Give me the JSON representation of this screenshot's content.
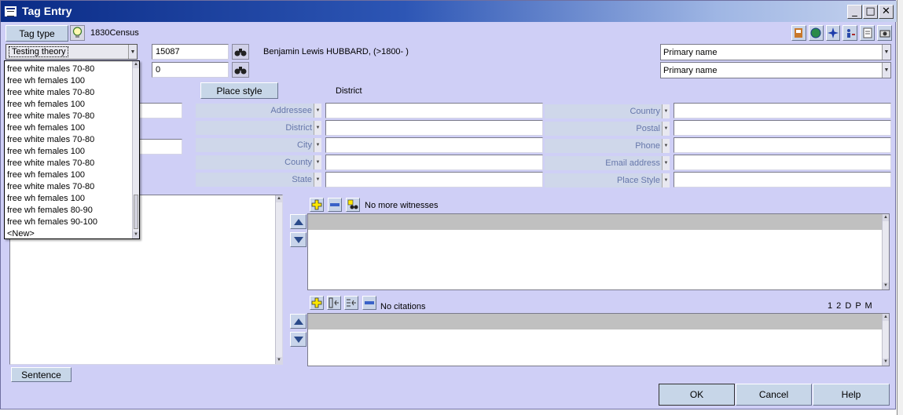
{
  "window": {
    "title": "Tag Entry",
    "minimize": "_",
    "maximize": "□",
    "close": "✕"
  },
  "header": {
    "tag_type_label": "Tag type",
    "tag_name": "1830Census"
  },
  "row1": {
    "role_value": "Testing theory",
    "id1": "15087",
    "person": "Benjamin Lewis HUBBARD, (>1800-  )",
    "name1": "Primary name"
  },
  "row2": {
    "id2": "0",
    "name2": "Primary name"
  },
  "place": {
    "style_button": "Place style",
    "district_label": "District"
  },
  "address_left": [
    "Addressee",
    "District",
    "City",
    "County",
    "State"
  ],
  "address_right": [
    "Country",
    "Postal",
    "Phone",
    "Email address",
    "Place Style"
  ],
  "dropdown": {
    "items": [
      "free white males 70-80",
      "free wh females 100",
      "free white males 70-80",
      "free wh females 100",
      "free white males 70-80",
      "free wh females 100",
      "free white males 70-80",
      "free wh females 100",
      "free white males 70-80",
      "free wh females 100",
      "free white males 70-80",
      "free wh females 100",
      "free wh females 80-90",
      "free wh females 90-100",
      "<New>"
    ]
  },
  "witnesses": {
    "status": "No more witnesses"
  },
  "citations": {
    "status": "No citations",
    "flags": "1 2 D P M"
  },
  "buttons": {
    "sentence": "Sentence",
    "ok": "OK",
    "cancel": "Cancel",
    "help": "Help"
  },
  "colors": {
    "title_bar_start": "#0a2b86",
    "window_bg": "#cfcff6",
    "label_text": "#6677aa",
    "grey_header": "#c0c0c0"
  }
}
